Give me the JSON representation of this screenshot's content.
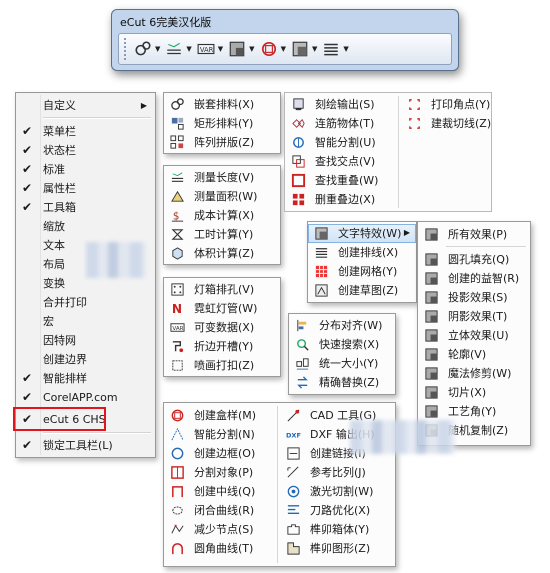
{
  "toolbar": {
    "title": "eCut 6完美汉化版",
    "buttons": [
      {
        "name": "nesting-icon"
      },
      {
        "name": "measure-icon"
      },
      {
        "name": "lamp-icon"
      },
      {
        "name": "create-box-icon"
      },
      {
        "name": "engrave-output-icon"
      },
      {
        "name": "text-effects-icon"
      },
      {
        "name": "align-icon"
      },
      {
        "name": "layout-icon"
      }
    ]
  },
  "context_menu": {
    "items": [
      {
        "label": "自定义",
        "checked": false,
        "submenu": true
      },
      {
        "label": "菜单栏",
        "checked": true
      },
      {
        "label": "状态栏",
        "checked": true
      },
      {
        "label": "标准",
        "checked": true
      },
      {
        "label": "属性栏",
        "checked": true
      },
      {
        "label": "工具箱",
        "checked": true
      },
      {
        "label": "缩放",
        "checked": false
      },
      {
        "label": "文本",
        "checked": false
      },
      {
        "label": "布局",
        "checked": false
      },
      {
        "label": "变换",
        "checked": false
      },
      {
        "label": "合并打印",
        "checked": false
      },
      {
        "label": "宏",
        "checked": false
      },
      {
        "label": "因特网",
        "checked": false
      },
      {
        "label": "创建边界",
        "checked": false
      },
      {
        "label": "智能排样",
        "checked": true
      },
      {
        "label": "CorelAPP.com",
        "checked": true
      },
      {
        "label": "eCut 6 CHS",
        "checked": true
      },
      {
        "label": "锁定工具栏(L)",
        "checked": true
      }
    ]
  },
  "panels": {
    "nesting": [
      "嵌套排料(X)",
      "矩形排料(Y)",
      "阵列拼版(Z)"
    ],
    "measure": [
      "测量长度(V)",
      "测量面积(W)",
      "成本计算(X)",
      "工时计算(Y)",
      "体积计算(Z)"
    ],
    "lamp": [
      "灯箱排孔(V)",
      "霓虹灯管(W)",
      "可变数据(X)",
      "折边开槽(Y)",
      "喷画打扣(Z)"
    ],
    "engrave_a": [
      "刻绘输出(S)",
      "连筋物体(T)",
      "智能分割(U)",
      "查找交点(V)",
      "查找重叠(W)",
      "删重叠边(X)"
    ],
    "engrave_b": [
      "打印角点(Y)",
      "建裁切线(Z)"
    ],
    "text": [
      "文字特效(W)",
      "创建排线(X)",
      "创建网格(Y)",
      "创建草图(Z)"
    ],
    "effects": [
      "所有效果(P)",
      "圆孔填充(Q)",
      "创建的益智(R)",
      "投影效果(S)",
      "阴影效果(T)",
      "立体效果(U)",
      "轮廓(V)",
      "魔法修剪(W)",
      "切片(X)",
      "工艺角(Y)",
      "随机复制(Z)"
    ],
    "align": [
      "分布对齐(W)",
      "快速搜索(X)",
      "统一大小(Y)",
      "精确替换(Z)"
    ],
    "create_a": [
      "创建盒样(M)",
      "智能分割(N)",
      "创建边框(O)",
      "分割对象(P)",
      "创建中线(Q)",
      "闭合曲线(R)",
      "减少节点(S)",
      "圆角曲线(T)"
    ],
    "create_b": [
      "CAD 工具(G)",
      "DXF 输出(H)",
      "创建链接(I)",
      "参考比列(J)",
      "激光切割(W)",
      "刀路优化(X)",
      "榫卯箱体(Y)",
      "榫卯图形(Z)"
    ]
  },
  "colors": {
    "highlight_border": "#e0161c",
    "menu_bg": "#f2f2f2",
    "toolbar_frame": "#c2d5ec"
  }
}
